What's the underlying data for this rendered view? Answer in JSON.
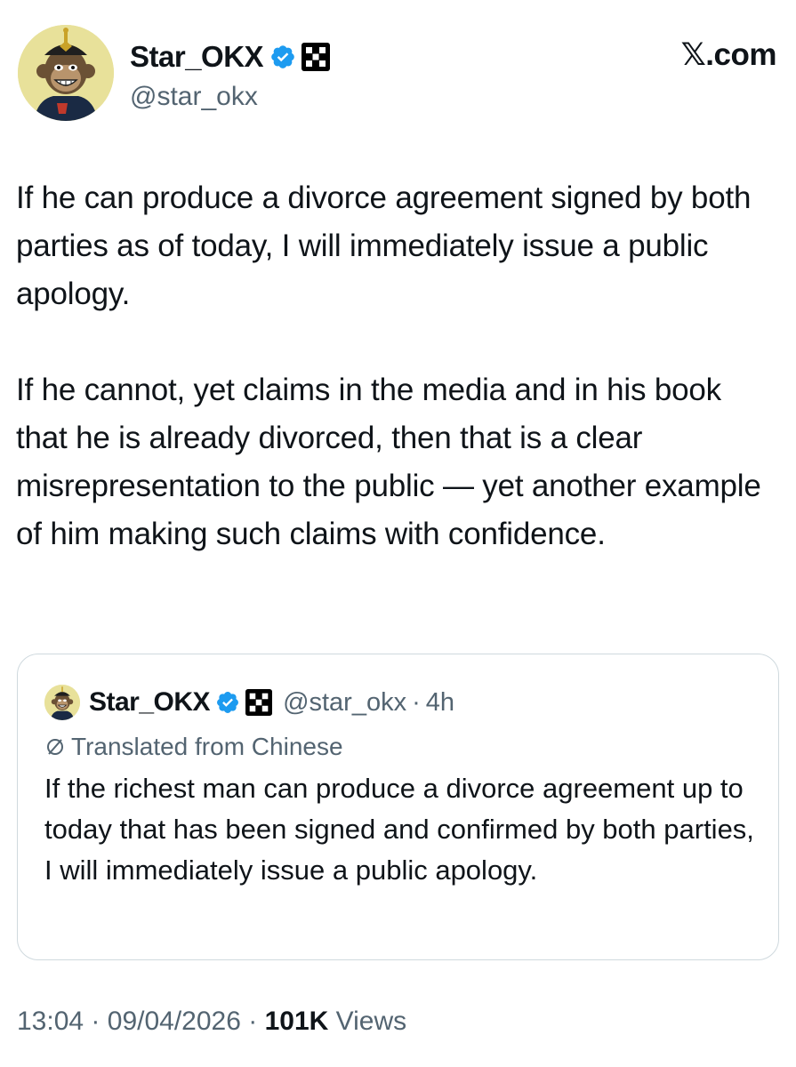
{
  "author": {
    "display_name": "Star_OKX",
    "handle": "@star_okx",
    "avatar_icon": "ape-avatar-icon",
    "verified_icon": "verified-badge-icon",
    "affiliate_icon": "okx-logo-icon"
  },
  "site_label": "𝕏.com",
  "post": {
    "paragraphs": [
      "If he can produce a divorce agreement signed by both parties as of today, I will immediately issue a public apology.",
      "If he cannot, yet claims in the media and in his book that he is already divorced, then that is a clear misrepresentation to the public — yet another example of him making such claims with confidence."
    ]
  },
  "quote": {
    "display_name": "Star_OKX",
    "handle": "@star_okx",
    "separator": "·",
    "time": "4h",
    "translated_label": "Translated from Chinese",
    "text": "If the richest man can produce a divorce agreement up to today that has been signed and confirmed by both parties, I will immediately issue a public apology."
  },
  "meta": {
    "time": "13:04",
    "separator": "·",
    "date": "09/04/2026",
    "views_count": "101K",
    "views_label": "Views"
  },
  "colors": {
    "verified_blue": "#1d9bf0",
    "text_primary": "#0f1419",
    "text_secondary": "#536471",
    "border": "#cfd9de"
  }
}
